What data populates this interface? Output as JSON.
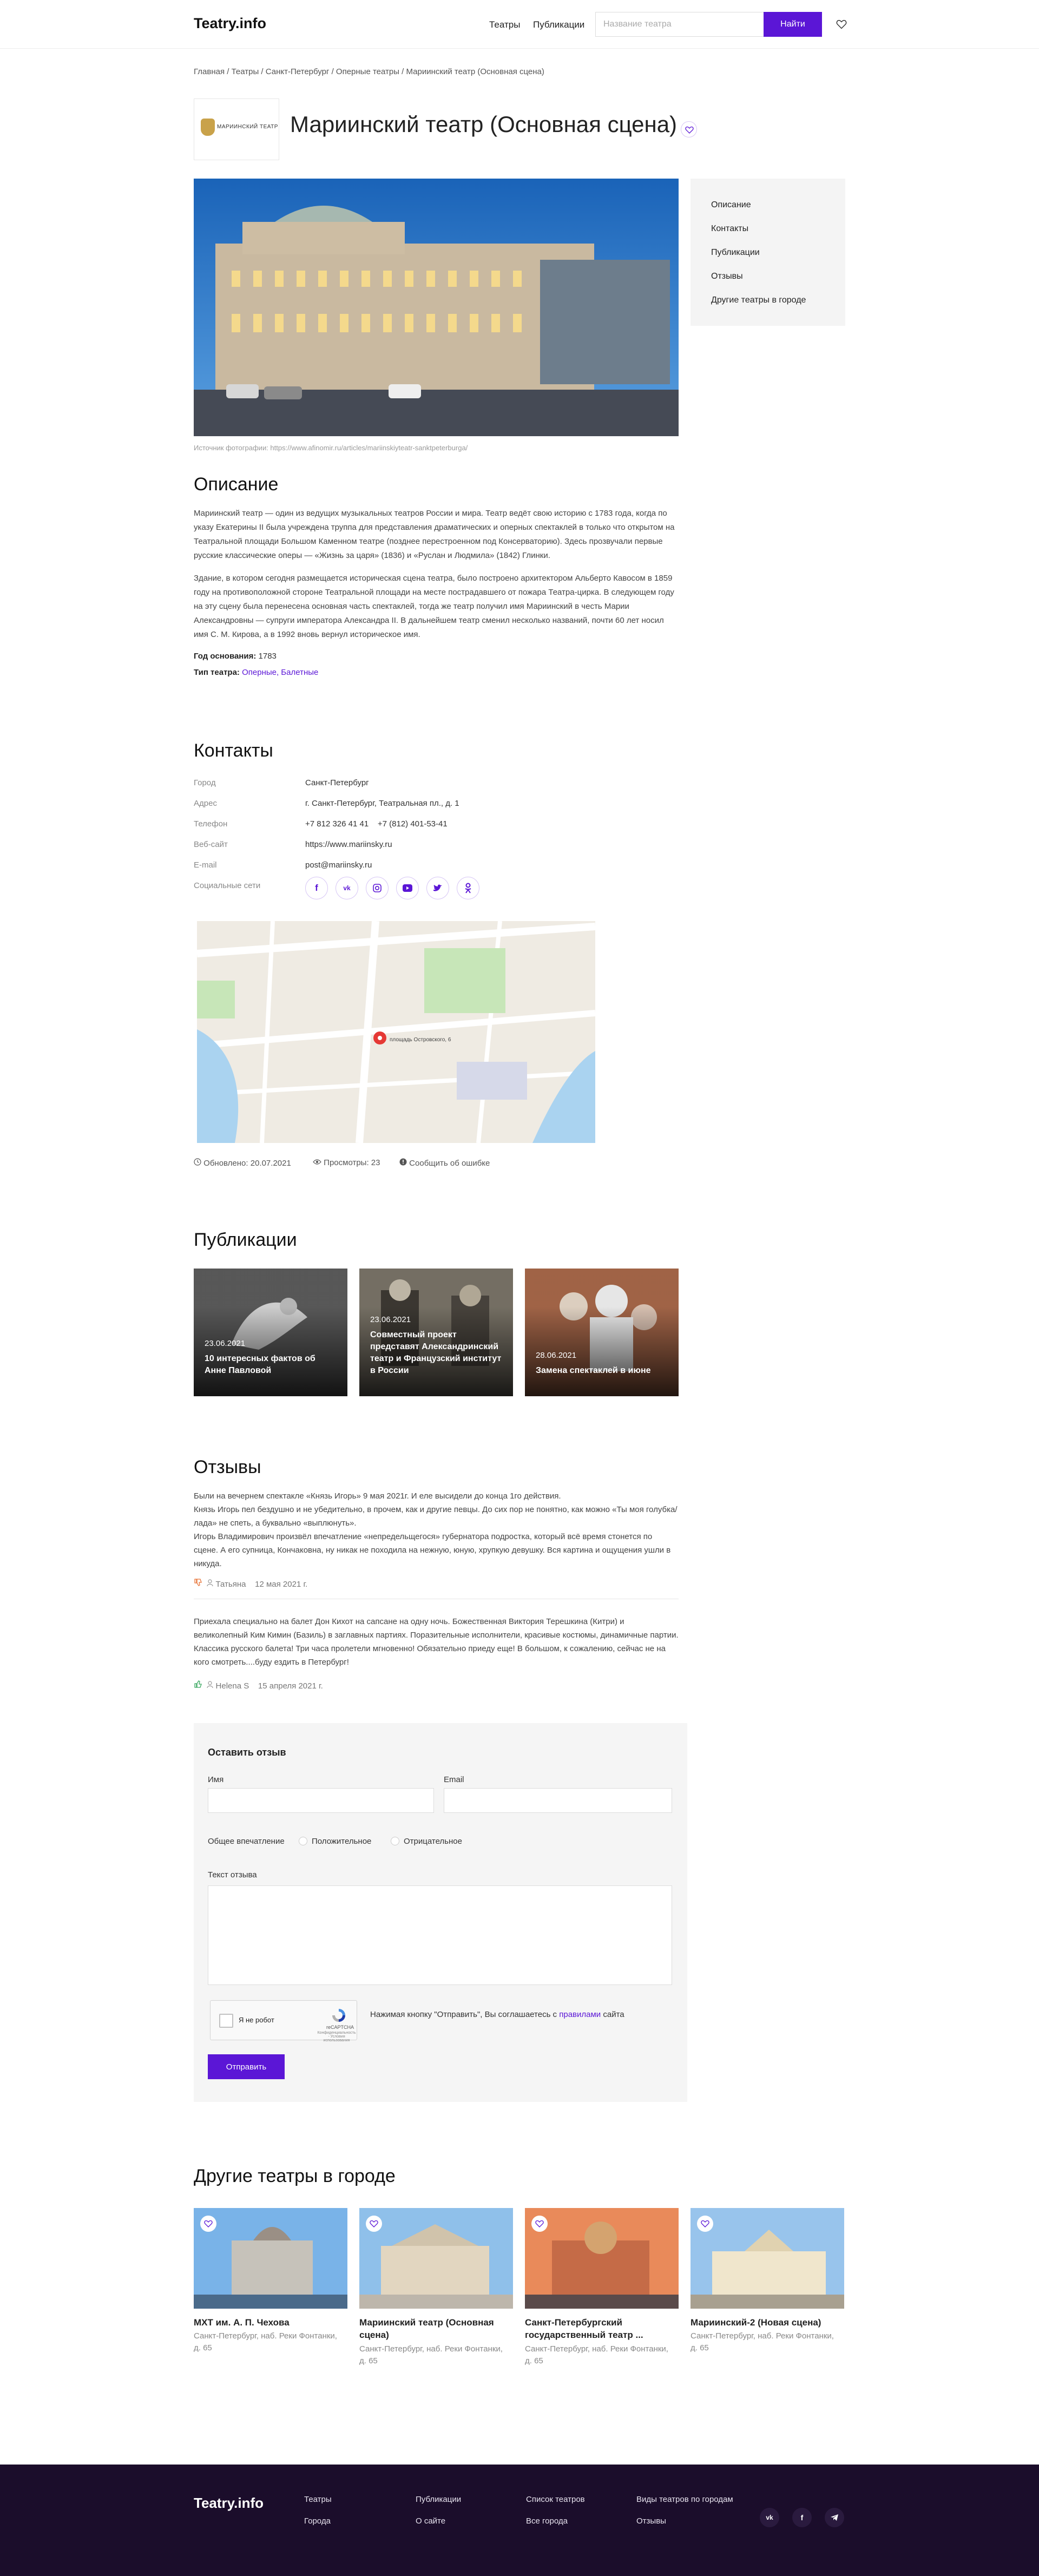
{
  "header": {
    "logo": "Teatry.info",
    "nav": [
      "Театры",
      "Публикации"
    ],
    "search_placeholder": "Название театра",
    "search_button": "Найти"
  },
  "breadcrumb": "Главная / Театры / Санкт-Петербург / Оперные театры / Мариинский театр (Основная сцена)",
  "theatre": {
    "logo_text": "МАРИИНСКИЙ ТЕАТР",
    "title": "Мариинский театр (Основная сцена)",
    "photo_source": "Источник фотографии: https://www.afinomir.ru/articles/mariinskiyteatr-sanktpeterburga/"
  },
  "side_nav": [
    "Описание",
    "Контакты",
    "Публикации",
    "Отзывы",
    "Другие театры в городе"
  ],
  "description": {
    "heading": "Описание",
    "p1": "Мариинский театр — один из ведущих музыкальных театров России и мира. Театр ведёт свою историю с 1783 года, когда по указу Екатерины II была учреждена труппа для представления драматических и оперных спектаклей в только что открытом на Театральной площади Большом Каменном театре (позднее перестроенном под Консерваторию). Здесь прозвучали первые русские классические оперы — «Жизнь за царя» (1836) и «Руслан и Людмила» (1842) Глинки.",
    "p2": "Здание, в котором сегодня размещается историческая сцена театра, было построено архитектором Альберто Кавосом в 1859 году на противоположной стороне Театральной площади на месте пострадавшего от пожара Театра-цирка. В следующем году на эту сцену была перенесена основная часть спектаклей, тогда же театр получил имя Мариинский в честь Марии Александровны — супруги императора Александра II. В дальнейшем театр сменил несколько названий, почти 60 лет носил имя С. М. Кирова, а в 1992 вновь вернул историческое имя.",
    "year_label": "Год основания:",
    "year": "1783",
    "type_label": "Тип театра:",
    "types": "Оперные, Балетные"
  },
  "contacts": {
    "heading": "Контакты",
    "rows": [
      {
        "label": "Город",
        "value": "Санкт-Петербург"
      },
      {
        "label": "Адрес",
        "value": "г. Санкт-Петербург, Театральная пл., д. 1"
      },
      {
        "label": "Телефон",
        "value": "+7 812 326 41 41    +7 (812) 401-53-41"
      },
      {
        "label": "Веб-сайт",
        "value": "https://www.mariinsky.ru"
      },
      {
        "label": "E-mail",
        "value": "post@mariinsky.ru"
      },
      {
        "label": "Социальные сети",
        "value": ""
      }
    ],
    "socials": [
      "f",
      "vk",
      "ig",
      "yt",
      "tw",
      "ok"
    ],
    "map_label": "площадь Островского, 6",
    "updated": "Обновлено: 20.07.2021",
    "views": "Просмотры: 23",
    "report": "Сообщить об ошибке"
  },
  "publications": {
    "heading": "Публикации",
    "items": [
      {
        "date": "23.06.2021",
        "title": "10 интересных фактов об Анне Павловой"
      },
      {
        "date": "23.06.2021",
        "title": "Совместный проект представят Александринский театр и Французский институт в России"
      },
      {
        "date": "28.06.2021",
        "title": "Замена спектаклей в июне"
      }
    ]
  },
  "reviews": {
    "heading": "Отзывы",
    "items": [
      {
        "text": "Были на вечернем спектакле «Князь Игорь» 9 мая 2021г. И еле высидели до конца 1го действия.\nКнязь Игорь пел бездушно и не убедительно, в прочем, как и другие певцы. До сих пор не понятно, как можно «Ты моя голубка/лада» не спеть, а буквально «выплюнуть».\nИгорь Владимирович произвёл впечатление «непредельщегося» губернатора подростка, который всё время стонется по сцене. А его супница, Кончаковна, ну никак не походила на нежную, юную, хрупкую девушку. Вся картина и ощущения ушли в никуда.",
        "author": "Татьяна",
        "date": "12 мая 2021 г."
      },
      {
        "text": "Приехала специально на балет Дон Кихот на сапсане на одну ночь. Божественная Виктория Терешкина (Китри) и великолепный Ким Кимин (Базиль) в заглавных партиях. Поразительные исполнители, красивые костюмы, динамичные партии. Классика русского балета! Три часа пролетели мгновенно! Обязательно приеду еще! В большом, к сожалению, сейчас не на кого смотреть....буду ездить в Петербург!",
        "author": "Helena S",
        "date": "15 апреля 2021 г."
      }
    ]
  },
  "review_form": {
    "title": "Оставить отзыв",
    "name_label": "Имя",
    "email_label": "Email",
    "impression_label": "Общее впечатление",
    "positive": "Положительное",
    "negative": "Отрицательное",
    "text_label": "Текст отзыва",
    "captcha_label": "Я не робот",
    "captcha_brand": "reCAPTCHA",
    "captcha_legal": "Конфиденциальность - Условия использования",
    "agree_prefix": "Нажимая кнопку \"Отправить\", Вы соглашаетесь с",
    "agree_link": "правилами",
    "agree_suffix": "сайта",
    "submit": "Отправить"
  },
  "other_theatres": {
    "heading": "Другие театры в городе",
    "items": [
      {
        "name": "МХТ им. А. П. Чехова",
        "address": "Санкт-Петербург, наб. Реки Фонтанки, д. 65"
      },
      {
        "name": "Мариинский театр (Основная сцена)",
        "address": "Санкт-Петербург, наб. Реки Фонтанки, д. 65"
      },
      {
        "name": "Санкт-Петербургский государственный театр ...",
        "address": "Санкт-Петербург, наб. Реки Фонтанки, д. 65"
      },
      {
        "name": "Мариинский-2 (Новая сцена)",
        "address": "Санкт-Петербург, наб. Реки Фонтанки, д. 65"
      }
    ]
  },
  "footer": {
    "logo": "Teatry.info",
    "links": [
      "Театры",
      "Города",
      "Публикации",
      "О сайте",
      "Список театров",
      "Все города",
      "Виды театров по городам",
      "Отзывы"
    ],
    "socials": [
      "vk",
      "f",
      "tg"
    ]
  },
  "colors": {
    "accent": "#5b16d6",
    "footer_bg": "#1b0d2b"
  }
}
